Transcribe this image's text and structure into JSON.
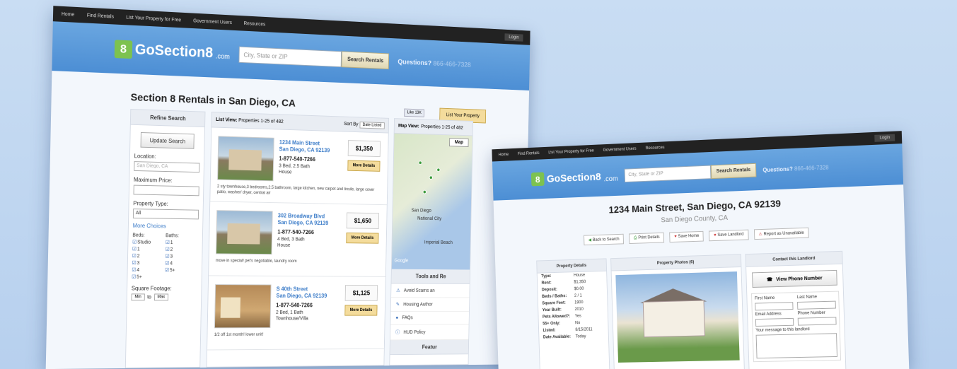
{
  "nav": [
    "Home",
    "Find Rentals",
    "List Your Property for Free",
    "Government Users",
    "Resources"
  ],
  "login": "Login",
  "logo": {
    "badge": "8",
    "name": "GoSection8",
    "tld": ".com"
  },
  "search": {
    "placeholder": "City, State or ZIP",
    "button": "Search Rentals"
  },
  "questions": {
    "label": "Questions?",
    "phone": "866-466-7328"
  },
  "list_page": {
    "title": "Section 8 Rentals in San Diego, CA",
    "like": "Like",
    "like_count": "13K",
    "list_property": "List Your Property",
    "refine": {
      "header": "Refine Search",
      "update": "Update Search",
      "location_label": "Location:",
      "location_value": "San Diego, CA",
      "max_price_label": "Maximum Price:",
      "property_type_label": "Property Type:",
      "property_type_value": "All",
      "more_choices": "More Choices",
      "beds_label": "Beds:",
      "baths_label": "Baths:",
      "beds": [
        "Studio",
        "1",
        "2",
        "3",
        "4",
        "5+"
      ],
      "baths": [
        "1",
        "2",
        "3",
        "4",
        "5+"
      ],
      "sqft_label": "Square Footage:",
      "min": "Min",
      "to": "to",
      "max": "Max"
    },
    "list_header": {
      "view": "List View:",
      "range": "Properties 1-25 of 482",
      "sort_label": "Sort By",
      "sort_value": "Date Listed"
    },
    "listings": [
      {
        "addr1": "1234 Main Street",
        "addr2": "San Diego, CA 92139",
        "phone": "1-877-540-7266",
        "beds": "3 Bed, 2.5 Bath",
        "type": "House",
        "price": "$1,350",
        "more": "More Details",
        "desc": "2 sty townhouse,3 bedrooms,2.5 bathroom, large kitchen, new carpet and tinsile, large cover patio, washer/ dryer, central air"
      },
      {
        "addr1": "302 Broadway Blvd",
        "addr2": "San Diego, CA 92139",
        "phone": "1-877-540-7266",
        "beds": "4 Bed, 3 Bath",
        "type": "House",
        "price": "$1,650",
        "more": "More Details",
        "desc": "move in special! pet's negotiable, laundry room"
      },
      {
        "addr1": "S 40th Street",
        "addr2": "San Diego, CA 92139",
        "phone": "1-877-540-7266",
        "beds": "2 Bed, 1 Bath",
        "type": "Townhouse/Villa",
        "price": "$1,125",
        "more": "More Details",
        "desc": "1/2 off 1st month! lower unit!"
      }
    ],
    "map": {
      "header": "Map View:",
      "range": "Properties 1-25 of 482",
      "type": "Map",
      "cities": [
        "San Diego",
        "National City",
        "Imperial Beach",
        "Google"
      ]
    },
    "tools": {
      "header": "Tools and Re",
      "items": [
        "Avoid Scams an",
        "Housing Author",
        "FAQs",
        "HUD Policy"
      ],
      "featured": "Featur"
    }
  },
  "detail_page": {
    "title": "1234 Main Street, San Diego, CA 92139",
    "county": "San Diego County, CA",
    "actions": [
      "Back to Search",
      "Print Details",
      "Save Home",
      "Save Landlord",
      "Report as Unavailable"
    ],
    "details_header": "Property Details",
    "details": [
      {
        "k": "Type:",
        "v": "House"
      },
      {
        "k": "Rent:",
        "v": "$1,350"
      },
      {
        "k": "Deposit:",
        "v": "$0.00"
      },
      {
        "k": "Beds / Baths:",
        "v": "2 / 1"
      },
      {
        "k": "Square Feet:",
        "v": "1900"
      },
      {
        "k": "Year Built:",
        "v": "2010"
      },
      {
        "k": "Pets Allowed?:",
        "v": "Yes"
      },
      {
        "k": "55+ Only:",
        "v": "No"
      },
      {
        "k": "Listed:",
        "v": "8/15/2011"
      },
      {
        "k": "Date Available:",
        "v": "Today"
      }
    ],
    "photos_header": "Property Photos (6)",
    "contact_header": "Contact this Landlord",
    "view_phone": "View Phone Number",
    "form": {
      "first": "First Name",
      "last": "Last Name",
      "email": "Email Address",
      "phone": "Phone Number",
      "message": "Your message to this landlord"
    }
  }
}
